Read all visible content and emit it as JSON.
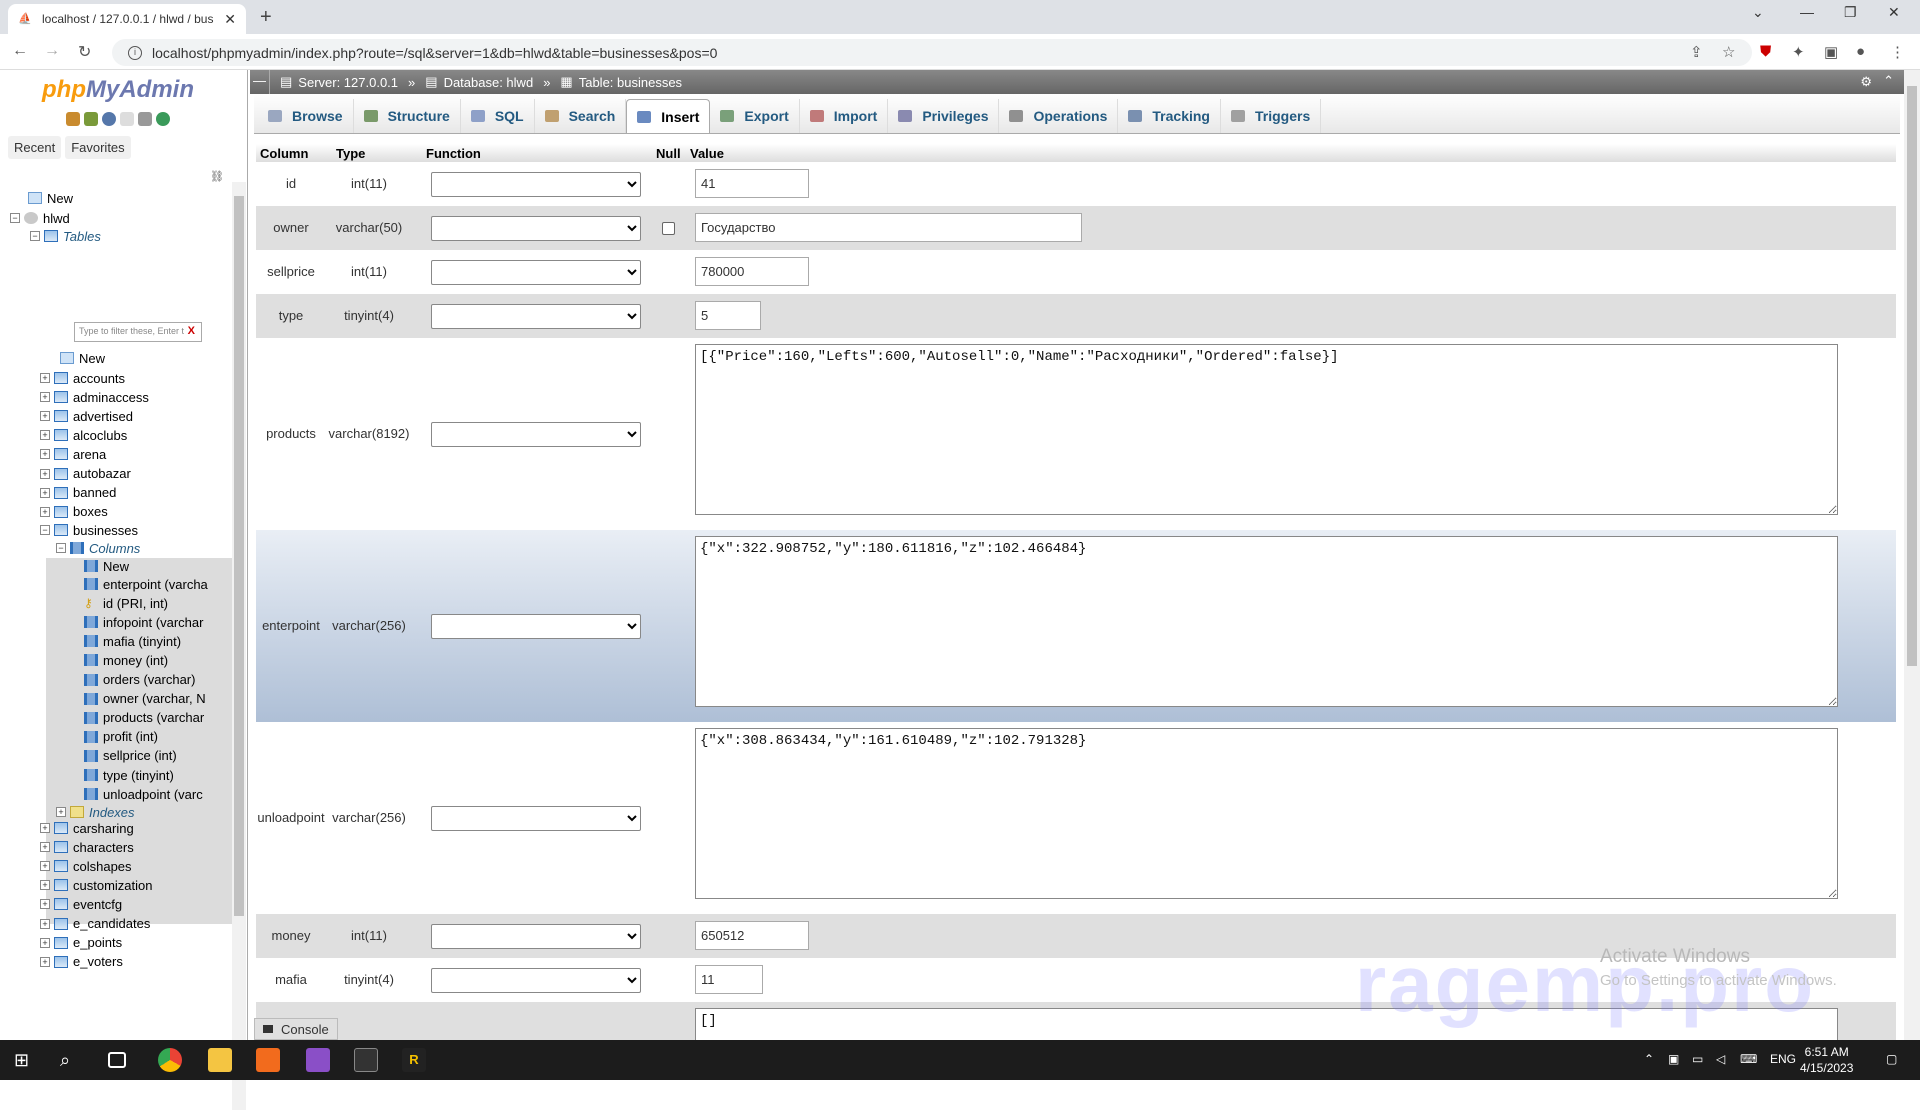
{
  "browser": {
    "tab_title": "localhost / 127.0.0.1 / hlwd / bus",
    "url": "localhost/phpmyadmin/index.php?route=/sql&server=1&db=hlwd&table=businesses&pos=0"
  },
  "sidebar": {
    "logo_php": "php",
    "logo_myadmin": "MyAdmin",
    "tabs": [
      "Recent",
      "Favorites"
    ],
    "tree_new": "New",
    "db_name": "hlwd",
    "tables_label": "Tables",
    "filter_placeholder": "Type to filter these, Enter t",
    "table_new": "New",
    "tables_before": [
      "accounts",
      "adminaccess",
      "advertised",
      "alcoclubs",
      "arena",
      "autobazar",
      "banned",
      "boxes"
    ],
    "selected_table": "businesses",
    "columns_label": "Columns",
    "columns_new": "New",
    "columns": [
      "enterpoint (varcha",
      "id (PRI, int)",
      "infopoint (varchar",
      "mafia (tinyint)",
      "money (int)",
      "orders (varchar)",
      "owner (varchar, N",
      "products (varchar",
      "profit (int)",
      "sellprice (int)",
      "type (tinyint)",
      "unloadpoint (varc"
    ],
    "indexes_label": "Indexes",
    "tables_after": [
      "carsharing",
      "characters",
      "colshapes",
      "customization",
      "eventcfg",
      "e_candidates",
      "e_points",
      "e_voters"
    ]
  },
  "breadcrumb": {
    "server": "Server: 127.0.0.1",
    "database": "Database: hlwd",
    "table": "Table: businesses"
  },
  "menu_tabs": [
    "Browse",
    "Structure",
    "SQL",
    "Search",
    "Insert",
    "Export",
    "Import",
    "Privileges",
    "Operations",
    "Tracking",
    "Triggers"
  ],
  "active_tab": "Insert",
  "grid_headers": {
    "column": "Column",
    "type": "Type",
    "function": "Function",
    "null": "Null",
    "value": "Value"
  },
  "rows": [
    {
      "name": "id",
      "type": "int(11)",
      "value": "41"
    },
    {
      "name": "owner",
      "type": "varchar(50)",
      "value": "Государство"
    },
    {
      "name": "sellprice",
      "type": "int(11)",
      "value": "780000"
    },
    {
      "name": "type",
      "type": "tinyint(4)",
      "value": "5"
    },
    {
      "name": "products",
      "type": "varchar(8192)",
      "value": "[{\"Price\":160,\"Lefts\":600,\"Autosell\":0,\"Name\":\"Расходники\",\"Ordered\":false}]"
    },
    {
      "name": "enterpoint",
      "type": "varchar(256)",
      "value": "{\"x\":322.908752,\"y\":180.611816,\"z\":102.466484}"
    },
    {
      "name": "unloadpoint",
      "type": "varchar(256)",
      "value": "{\"x\":308.863434,\"y\":161.610489,\"z\":102.791328}"
    },
    {
      "name": "money",
      "type": "int(11)",
      "value": "650512"
    },
    {
      "name": "mafia",
      "type": "tinyint(4)",
      "value": "11"
    },
    {
      "name": "",
      "type": "",
      "value": "[]"
    }
  ],
  "console_label": "Console",
  "watermark": {
    "activate_title": "Activate Windows",
    "activate_sub": "Go to Settings to activate Windows.",
    "brand": "ragemp.pro"
  },
  "taskbar": {
    "lang": "ENG",
    "time": "6:51 AM",
    "date": "4/15/2023"
  }
}
